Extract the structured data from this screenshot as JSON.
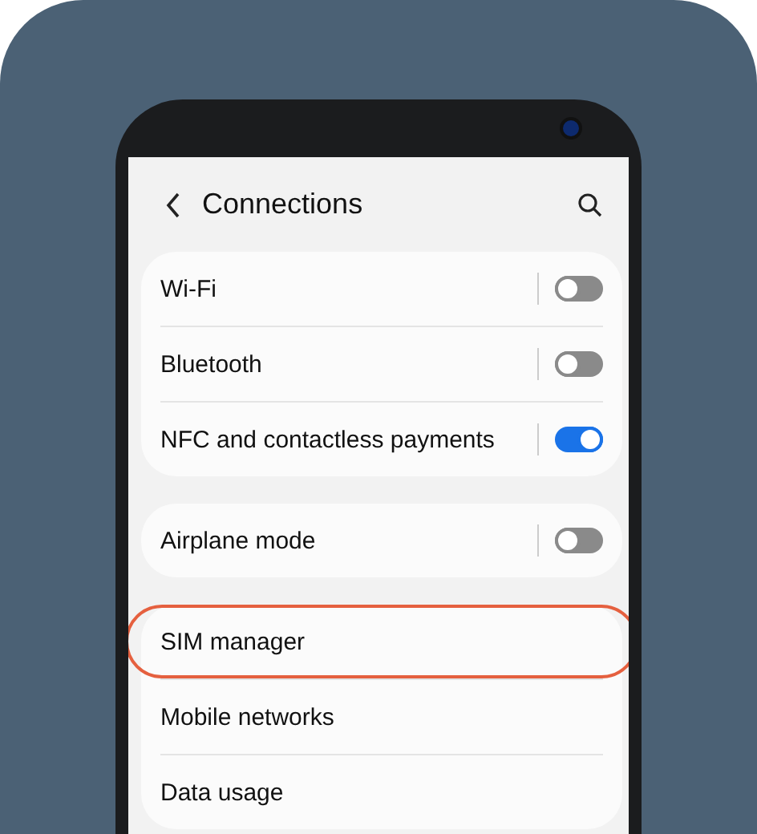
{
  "header": {
    "title": "Connections"
  },
  "groups": [
    {
      "items": [
        {
          "label": "Wi-Fi",
          "kind": "toggle",
          "on": false
        },
        {
          "label": "Bluetooth",
          "kind": "toggle",
          "on": false
        },
        {
          "label": "NFC and contactless payments",
          "kind": "toggle",
          "on": true
        }
      ]
    },
    {
      "items": [
        {
          "label": "Airplane mode",
          "kind": "toggle",
          "on": false
        }
      ]
    },
    {
      "items": [
        {
          "label": "SIM manager",
          "kind": "link",
          "highlighted": true
        },
        {
          "label": "Mobile networks",
          "kind": "link",
          "highlighted": false
        },
        {
          "label": "Data usage",
          "kind": "link",
          "highlighted": false
        }
      ]
    }
  ]
}
